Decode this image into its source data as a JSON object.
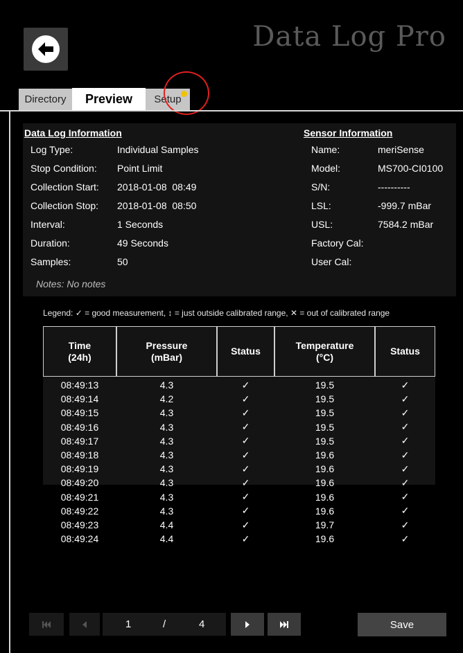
{
  "app": {
    "title": "Data Log Pro"
  },
  "tabs": [
    {
      "label": "Directory"
    },
    {
      "label": "Preview"
    },
    {
      "label": "Setup"
    }
  ],
  "log_info": {
    "heading": "Data Log Information",
    "rows": [
      {
        "label": "Log Type:",
        "value": "Individual Samples"
      },
      {
        "label": "Stop Condition:",
        "value": "Point Limit"
      },
      {
        "label": "Collection Start:",
        "value": "2018-01-08  08:49"
      },
      {
        "label": "Collection Stop:",
        "value": "2018-01-08  08:50"
      },
      {
        "label": "Interval:",
        "value": "1 Seconds"
      },
      {
        "label": "Duration:",
        "value": "49 Seconds"
      },
      {
        "label": "Samples:",
        "value": "50"
      }
    ],
    "notes": "Notes: No notes"
  },
  "sensor_info": {
    "heading": "Sensor Information",
    "rows": [
      {
        "label": "Name:",
        "value": "meriSense"
      },
      {
        "label": "Model:",
        "value": "MS700-CI0100"
      },
      {
        "label": "S/N:",
        "value": "----------"
      },
      {
        "label": "LSL:",
        "value": "-999.7 mBar"
      },
      {
        "label": "USL:",
        "value": "7584.2 mBar"
      },
      {
        "label": "Factory Cal:",
        "value": ""
      },
      {
        "label": "User Cal:",
        "value": ""
      }
    ]
  },
  "legend": "Legend:  ✓ = good measurement,  ↕ = just outside calibrated range,  ✕ = out of calibrated range",
  "table": {
    "headers": [
      "Time\n(24h)",
      "Pressure\n(mBar)",
      "Status",
      "Temperature\n(°C)",
      "Status"
    ],
    "rows": [
      [
        "08:49:13",
        "4.3",
        "✓",
        "19.5",
        "✓"
      ],
      [
        "08:49:14",
        "4.2",
        "✓",
        "19.5",
        "✓"
      ],
      [
        "08:49:15",
        "4.3",
        "✓",
        "19.5",
        "✓"
      ],
      [
        "08:49:16",
        "4.3",
        "✓",
        "19.5",
        "✓"
      ],
      [
        "08:49:17",
        "4.3",
        "✓",
        "19.5",
        "✓"
      ],
      [
        "08:49:18",
        "4.3",
        "✓",
        "19.6",
        "✓"
      ],
      [
        "08:49:19",
        "4.3",
        "✓",
        "19.6",
        "✓"
      ],
      [
        "08:49:20",
        "4.3",
        "✓",
        "19.6",
        "✓"
      ],
      [
        "08:49:21",
        "4.3",
        "✓",
        "19.6",
        "✓"
      ],
      [
        "08:49:22",
        "4.3",
        "✓",
        "19.6",
        "✓"
      ],
      [
        "08:49:23",
        "4.4",
        "✓",
        "19.7",
        "✓"
      ],
      [
        "08:49:24",
        "4.4",
        "✓",
        "19.6",
        "✓"
      ]
    ]
  },
  "pagination": {
    "current": "1",
    "separator": "/",
    "total": "4"
  },
  "save_label": "Save",
  "icons": {
    "back": "arrow-left-circle-icon",
    "first": "skip-first-icon",
    "prev": "previous-icon",
    "next": "next-icon",
    "last": "skip-last-icon"
  },
  "colors": {
    "accent_dot": "#f2c200",
    "highlight_circle": "#e02020",
    "title": "#5a5a5a"
  }
}
